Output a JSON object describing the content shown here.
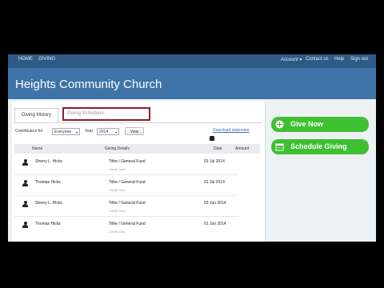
{
  "nav": {
    "left": [
      "HOME",
      "GIVING"
    ],
    "account": "Account",
    "contact": "Contact us",
    "help": "Help",
    "signout": "Sign out"
  },
  "church": "Heights Community Church",
  "tabs": {
    "history": "Giving History",
    "schedules": "Giving Schedules"
  },
  "filters": {
    "contributors_label": "Contributors for",
    "contributors_value": "Everyone",
    "year_label": "Year",
    "year_value": "2014",
    "view": "View"
  },
  "download": "Download statement",
  "table": {
    "headers": {
      "name": "Name",
      "details": "Giving Details",
      "date": "Date",
      "amount": "Amount"
    },
    "rows": [
      {
        "name": "Sherry L. Hicks",
        "fund": "Tithe / General Fund",
        "method": "Credit Card",
        "date": "03 Jul 2014"
      },
      {
        "name": "Thomas Hicks",
        "fund": "Tithe / General Fund",
        "method": "Credit Card",
        "date": "01 Jul 2014"
      },
      {
        "name": "Sherry L. Hicks",
        "fund": "Tithe / General Fund",
        "method": "Credit Card",
        "date": "03 Jun 2014"
      },
      {
        "name": "Thomas Hicks",
        "fund": "Tithe / General Fund",
        "method": "Credit Card",
        "date": "01 Jun 2014"
      }
    ]
  },
  "actions": {
    "give_now": "Give Now",
    "schedule": "Schedule Giving"
  },
  "colors": {
    "nav": "#2e5a86",
    "header": "#3f73a8",
    "accent_green": "#3fbf32",
    "tab_highlight": "#8e1f22",
    "link": "#3a6fb0"
  },
  "icons": [
    "user-icon",
    "plus-circle-icon",
    "calendar-icon",
    "printer-icon",
    "caret-down-icon"
  ]
}
